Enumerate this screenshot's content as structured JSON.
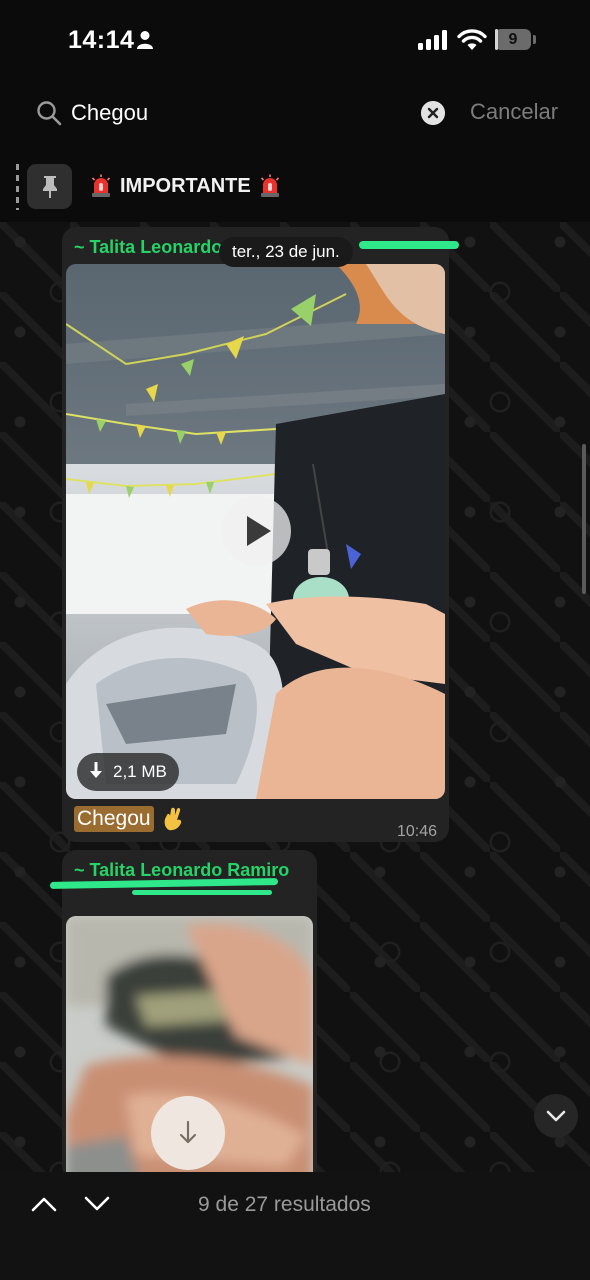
{
  "status_bar": {
    "time": "14:14",
    "battery_level": "9",
    "battery_fraction": 0.09
  },
  "search": {
    "query": "Chegou",
    "cancel_label": "Cancelar"
  },
  "pinned": {
    "text": "IMPORTANTE"
  },
  "messages": [
    {
      "sender": "~ Talita Leonardo",
      "date_chip": "ter., 23 de jun.",
      "media_type": "video",
      "file_size": "2,1 MB",
      "caption": "Chegou",
      "time": "10:46"
    },
    {
      "sender": "~ Talita Leonardo Ramiro",
      "media_type": "video"
    }
  ],
  "results": {
    "text": "9 de 27 resultados"
  },
  "colors": {
    "accent_green": "#25d366",
    "highlight": "#9b6c2f",
    "background": "#0b0b0b"
  }
}
